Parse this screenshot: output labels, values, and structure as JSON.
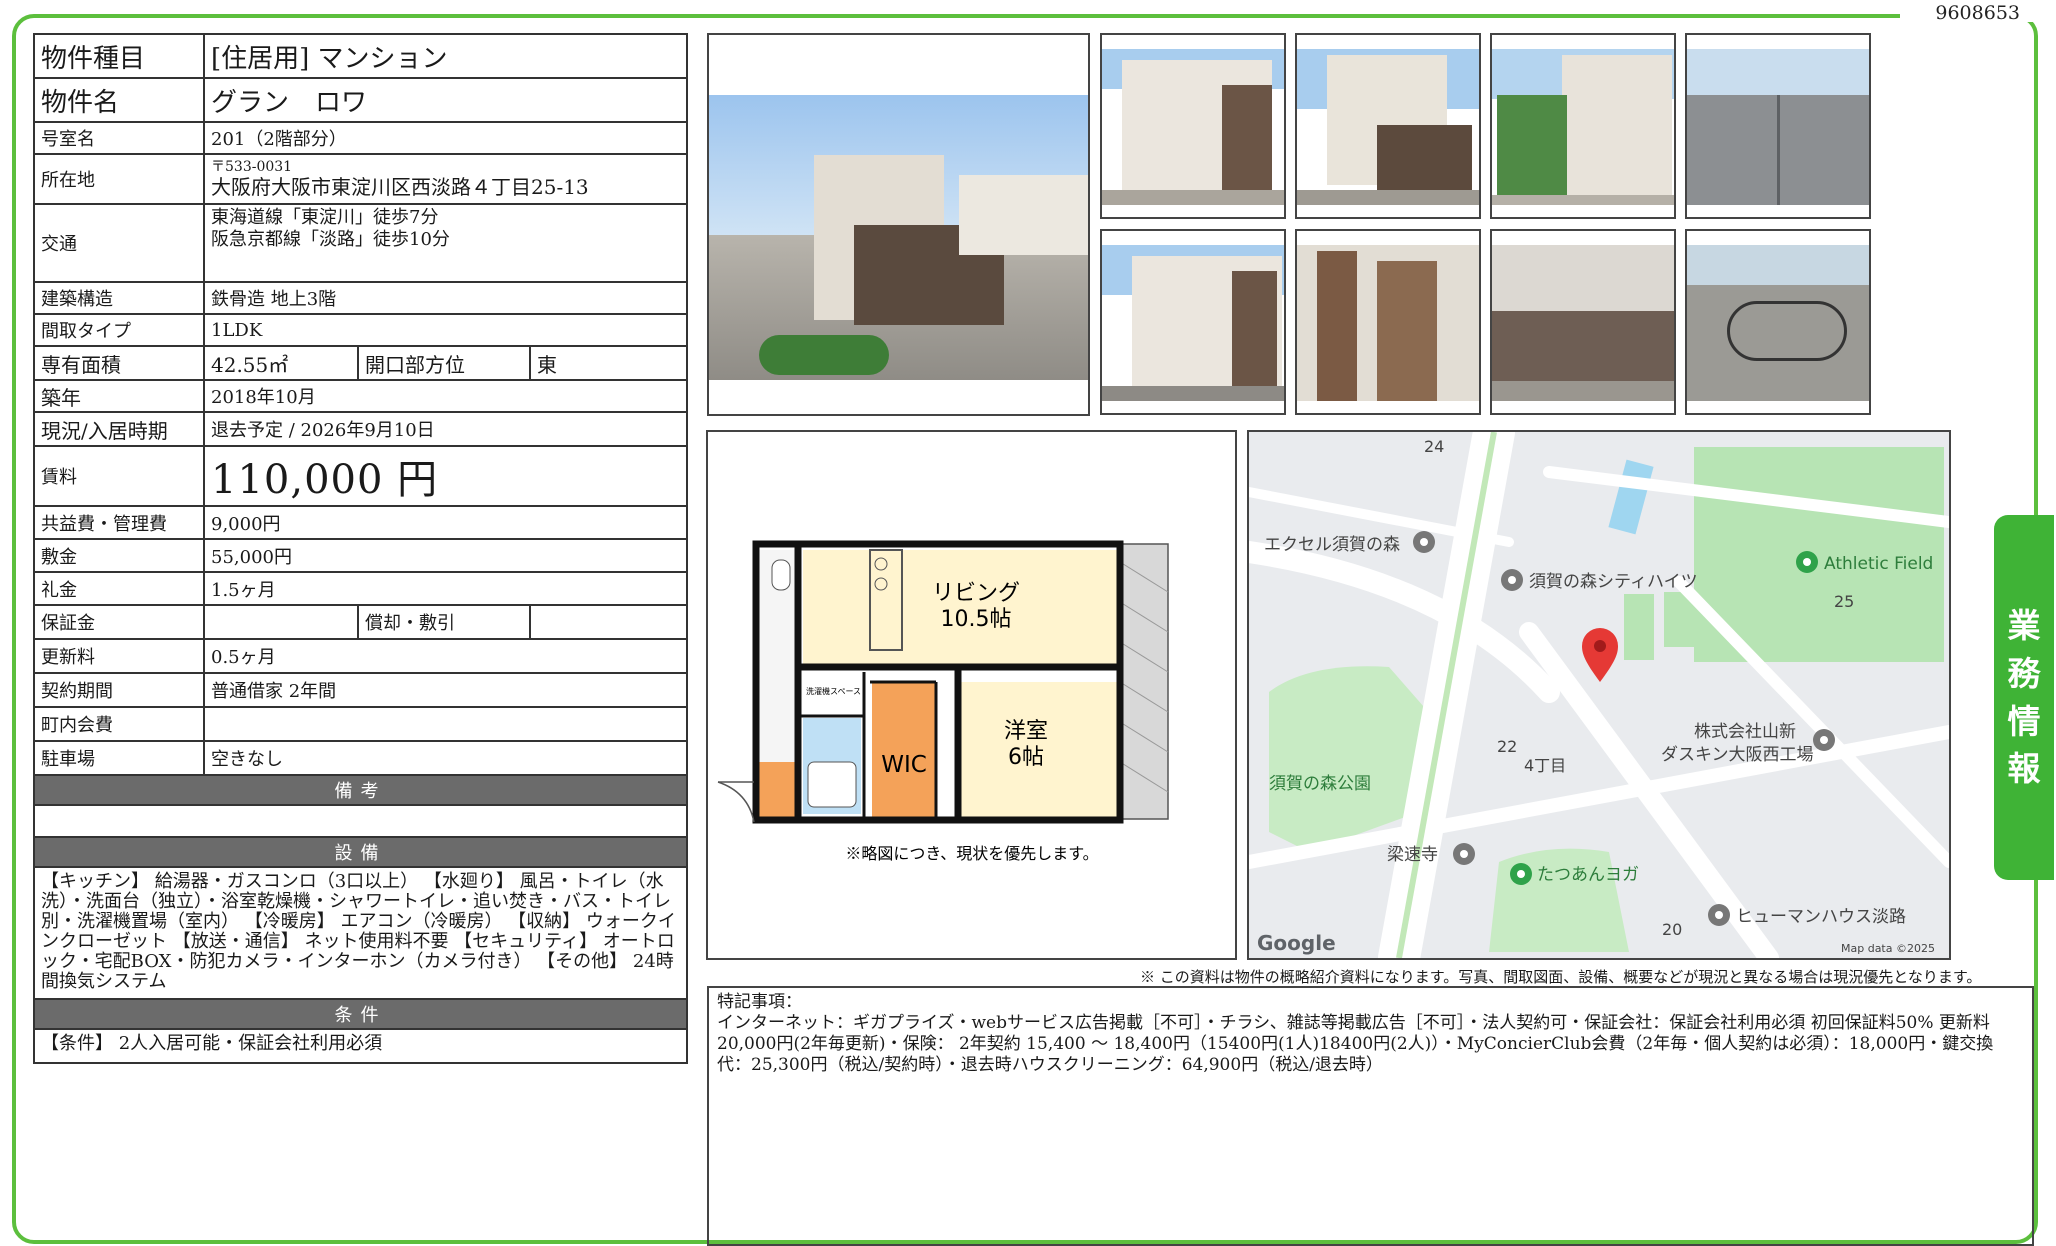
{
  "doc_number": "9608653",
  "side_tab": [
    "業",
    "務",
    "情",
    "報"
  ],
  "property": {
    "type_label": "物件種目",
    "type_value": "[住居用] マンション",
    "name_label": "物件名",
    "name_value": "グラン　ロワ",
    "room_label": "号室名",
    "room_value": "201（2階部分）",
    "address_label": "所在地",
    "postal": "〒533-0031",
    "address": "大阪府大阪市東淀川区西淡路４丁目25-13",
    "transport_label": "交通",
    "transport_1": "東海道線「東淀川」徒歩7分",
    "transport_2": "阪急京都線「淡路」徒歩10分",
    "structure_label": "建築構造",
    "structure_value": "鉄骨造 地上3階",
    "layout_label": "間取タイプ",
    "layout_value": "1LDK",
    "area_label": "専有面積",
    "area_value": "42.55㎡",
    "direction_label": "開口部方位",
    "direction_value": "東",
    "built_label": "築年",
    "built_value": "2018年10月",
    "status_label": "現況/入居時期",
    "status_value": "退去予定 /  2026年9月10日",
    "rent_label": "賃料",
    "rent_value": "110,000 円",
    "fee_label": "共益費・管理費",
    "fee_value": "9,000円",
    "deposit_label": "敷金",
    "deposit_value": "55,000円",
    "key_money_label": "礼金",
    "key_money_value": "1.5ヶ月",
    "guarantee_label": "保証金",
    "guarantee_value": "",
    "amort_label": "償却・敷引",
    "amort_value": "",
    "renewal_label": "更新料",
    "renewal_value": "0.5ヶ月",
    "contract_label": "契約期間",
    "contract_value": "普通借家 2年間",
    "community_label": "町内会費",
    "community_value": "",
    "parking_label": "駐車場",
    "parking_value": "空きなし"
  },
  "sections": {
    "remarks": "備考",
    "remarks_text": "",
    "facilities": "設備",
    "facilities_text": "【キッチン】 給湯器・ガスコンロ（3口以上） 【水廻り】 風呂・トイレ（水洗）・洗面台（独立）・浴室乾燥機・シャワートイレ・追い焚き・バス・トイレ別・洗濯機置場（室内） 【冷暖房】 エアコン（冷暖房） 【収納】 ウォークインクローゼット 【放送・通信】 ネット使用料不要 【セキュリティ】 オートロック・宅配BOX・防犯カメラ・インターホン（カメラ付き） 【その他】 24時間換気システム",
    "conditions": "条件",
    "conditions_text": "【条件】 2人入居可能・保証会社利用必須"
  },
  "floorplan": {
    "living": "リビング",
    "living_size": "10.5帖",
    "western": "洋室",
    "western_size": "6帖",
    "wic": "WIC",
    "laundry": "洗濯機スペース",
    "caption": "※略図につき、現状を優先します。"
  },
  "map": {
    "labels": [
      "エクセル須賀の森",
      "須賀の森シティハイツ",
      "Athletic Field",
      "株式会社山新",
      "ダスキン大阪西工場",
      "須賀の森公園",
      "梁速寺",
      "たつあんヨガ",
      "ヒューマンハウス淡路",
      "4丁目"
    ],
    "numbers": [
      "24",
      "25",
      "22",
      "20"
    ],
    "google": "Google",
    "copyright": "Map data ©2025"
  },
  "disclaimer": "※ この資料は物件の概略紹介資料になります。写真、間取図面、設備、概要などが現況と異なる場合は現況優先となります。",
  "notes": {
    "title": "特記事項：",
    "text": "インターネット：ギガプライズ・webサービス広告掲載［不可］・チラシ、雑誌等掲載広告［不可］・法人契約可・保証会社：保証会社利用必須 初回保証料50% 更新料20,000円(2年毎更新)・保険： 2年契約 15,400 〜 18,400円（15400円(1人)18400円(2人)）・MyConcierClub会費（2年毎・個人契約は必須）：18,000円・鍵交換代：25,300円（税込/契約時）・退去時ハウスクリーニング：64,900円（税込/退去時）"
  },
  "colors": {
    "frame": "#5cbf3d",
    "tab": "#3fb336",
    "section_bar": "#6b6b6b",
    "map_park": "#b7e4b4",
    "map_road": "#ffffff"
  }
}
